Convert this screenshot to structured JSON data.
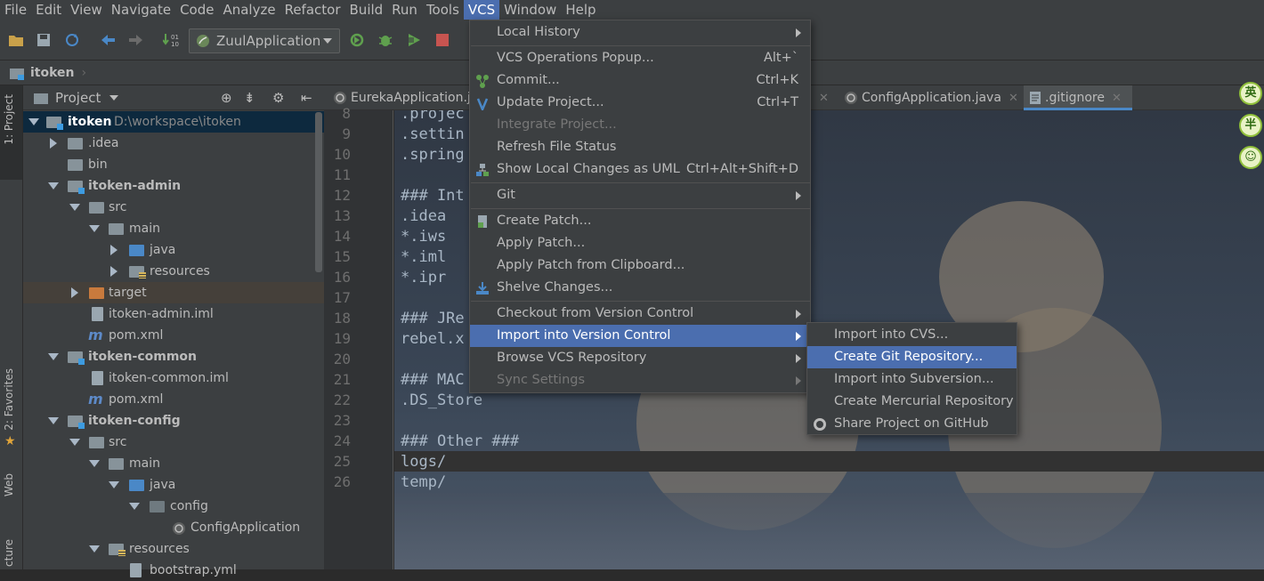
{
  "menubar": {
    "items": [
      "File",
      "Edit",
      "View",
      "Navigate",
      "Code",
      "Analyze",
      "Refactor",
      "Build",
      "Run",
      "Tools",
      "VCS",
      "Window",
      "Help"
    ],
    "active": "VCS"
  },
  "toolbar": {
    "run_config": "ZuulApplication"
  },
  "navbar": {
    "breadcrumb": "itoken"
  },
  "left_tools": {
    "project_tab": "1: Project",
    "favorites_tab": "2: Favorites",
    "web_tab": "Web",
    "structure_tab": "cture"
  },
  "project_panel": {
    "title": "Project",
    "tree": [
      {
        "label": "itoken",
        "hint": "D:\\workspace\\itoken"
      },
      {
        "label": ".idea"
      },
      {
        "label": "bin"
      },
      {
        "label": "itoken-admin"
      },
      {
        "label": "src"
      },
      {
        "label": "main"
      },
      {
        "label": "java"
      },
      {
        "label": "resources"
      },
      {
        "label": "target"
      },
      {
        "label": "itoken-admin.iml"
      },
      {
        "label": "pom.xml"
      },
      {
        "label": "itoken-common"
      },
      {
        "label": "itoken-common.iml"
      },
      {
        "label": "pom.xml"
      },
      {
        "label": "itoken-config"
      },
      {
        "label": "src"
      },
      {
        "label": "main"
      },
      {
        "label": "java"
      },
      {
        "label": "config"
      },
      {
        "label": "ConfigApplication"
      },
      {
        "label": "resources"
      },
      {
        "label": "bootstrap.yml"
      }
    ]
  },
  "editor_tabs": {
    "tab1": "EurekaApplication.j",
    "tab2": "ConfigApplication.java",
    "tab3": ".gitignore"
  },
  "editor": {
    "lines": [
      {
        "no": "8",
        "text": ".projec"
      },
      {
        "no": "9",
        "text": ".settin"
      },
      {
        "no": "10",
        "text": ".spring"
      },
      {
        "no": "11",
        "text": ""
      },
      {
        "no": "12",
        "text": "### Int"
      },
      {
        "no": "13",
        "text": ".idea"
      },
      {
        "no": "14",
        "text": "*.iws"
      },
      {
        "no": "15",
        "text": "*.iml"
      },
      {
        "no": "16",
        "text": "*.ipr"
      },
      {
        "no": "17",
        "text": ""
      },
      {
        "no": "18",
        "text": "### JRe"
      },
      {
        "no": "19",
        "text": "rebel.x"
      },
      {
        "no": "20",
        "text": ""
      },
      {
        "no": "21",
        "text": "### MAC"
      },
      {
        "no": "22",
        "text": ".DS_Store"
      },
      {
        "no": "23",
        "text": ""
      },
      {
        "no": "24",
        "text": "### Other ###"
      },
      {
        "no": "25",
        "text": "logs/"
      },
      {
        "no": "26",
        "text": "temp/"
      }
    ]
  },
  "vcs_menu": {
    "local_history": "Local History",
    "vcs_operations": "VCS Operations Popup...",
    "vcs_operations_key": "Alt+`",
    "commit": "Commit...",
    "commit_key": "Ctrl+K",
    "update_project": "Update Project...",
    "update_project_key": "Ctrl+T",
    "integrate_project": "Integrate Project...",
    "refresh_status": "Refresh File Status",
    "show_local_changes": "Show Local Changes as UML",
    "show_local_changes_key": "Ctrl+Alt+Shift+D",
    "git": "Git",
    "create_patch": "Create Patch...",
    "apply_patch": "Apply Patch...",
    "apply_patch_clipboard": "Apply Patch from Clipboard...",
    "shelve_changes": "Shelve Changes...",
    "checkout": "Checkout from Version Control",
    "import_vc": "Import into Version Control",
    "browse_repo": "Browse VCS Repository",
    "sync_settings": "Sync Settings"
  },
  "import_submenu": {
    "cvs": "Import into CVS...",
    "git": "Create Git Repository...",
    "svn": "Import into Subversion...",
    "hg": "Create Mercurial Repository",
    "github": "Share Project on GitHub"
  },
  "ime": {
    "lang": "英",
    "width": "半"
  },
  "colors": {
    "highlight": "#4b6eaf",
    "menu_bg": "#3c3f41",
    "editor_bg": "#2b2b2b"
  }
}
